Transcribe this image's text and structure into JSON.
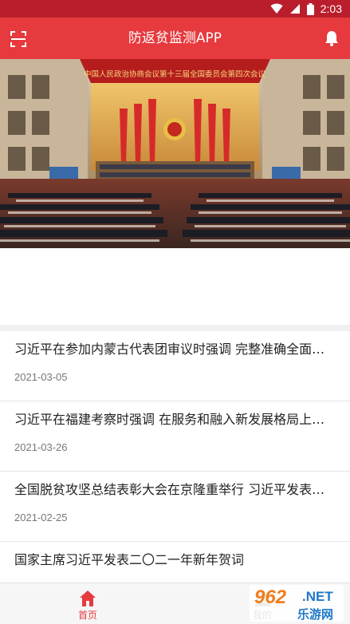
{
  "status_bar": {
    "time": "2:03"
  },
  "app_bar": {
    "title": "防返贫监测APP"
  },
  "banner": {
    "banner_text": "中国人民政治协商会议第十三届全国委员会第四次会议"
  },
  "news": [
    {
      "headline": "习近平在参加内蒙古代表团审议时强调 完整准确全面贯彻新发展理念",
      "date": "2021-03-05"
    },
    {
      "headline": "习近平在福建考察时强调 在服务和融入新发展格局上展现更大作为",
      "date": "2021-03-26"
    },
    {
      "headline": "全国脱贫攻坚总结表彰大会在京隆重举行 习近平发表重要讲话",
      "date": "2021-02-25"
    },
    {
      "headline": "国家主席习近平发表二〇二一年新年贺词",
      "date": ""
    }
  ],
  "tabs": {
    "home_label": "首页",
    "mine_label": "我的"
  },
  "watermark": {
    "number": "962",
    "net": ".NET",
    "cn": "乐游网"
  },
  "colors": {
    "primary": "#e63a3e",
    "status": "#ba1e2c"
  },
  "icons": [
    "scan-icon",
    "bell-icon",
    "wifi-icon",
    "signal-icon",
    "battery-icon",
    "home-icon",
    "user-icon"
  ]
}
